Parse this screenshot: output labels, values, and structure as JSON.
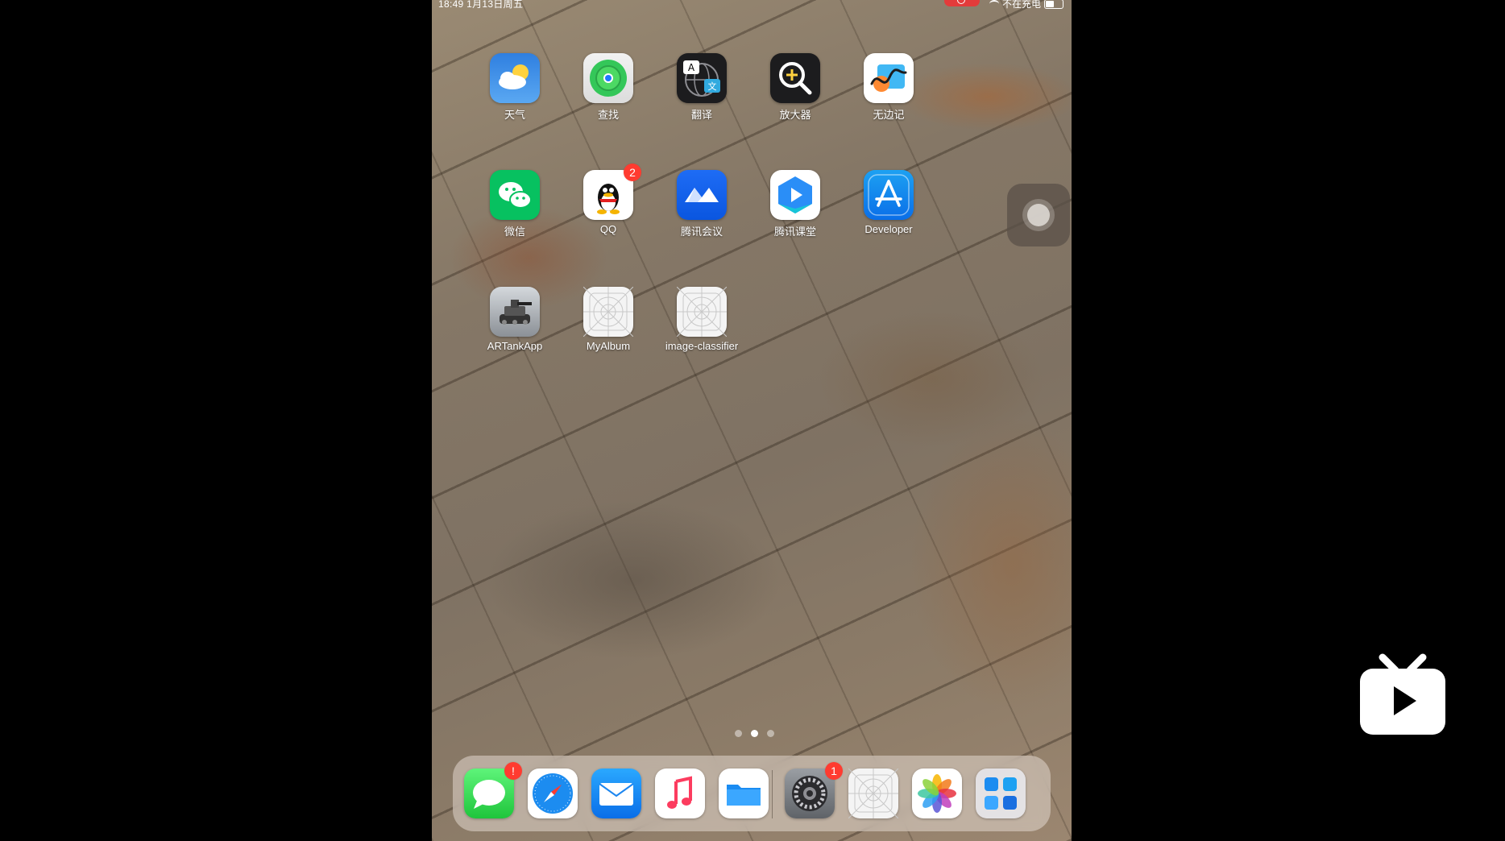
{
  "status_bar": {
    "time": "18:49  1月13日周五",
    "charging": "不在充电"
  },
  "apps": [
    {
      "name": "weather",
      "label": "天气",
      "icon": "weather-icon"
    },
    {
      "name": "find-my",
      "label": "查找",
      "icon": "find-my-icon"
    },
    {
      "name": "translate",
      "label": "翻译",
      "icon": "translate-icon"
    },
    {
      "name": "magnifier",
      "label": "放大器",
      "icon": "magnifier-icon"
    },
    {
      "name": "freeform",
      "label": "无边记",
      "icon": "freeform-icon"
    },
    {
      "name": "wechat",
      "label": "微信",
      "icon": "wechat-icon"
    },
    {
      "name": "qq",
      "label": "QQ",
      "icon": "qq-icon",
      "badge": "2"
    },
    {
      "name": "tencent-meeting",
      "label": "腾讯会议",
      "icon": "tencent-meeting-icon"
    },
    {
      "name": "tencent-classroom",
      "label": "腾讯课堂",
      "icon": "tencent-classroom-icon"
    },
    {
      "name": "developer",
      "label": "Developer",
      "icon": "developer-icon"
    },
    {
      "name": "artankapp",
      "label": "ARTankApp",
      "icon": "tank-icon"
    },
    {
      "name": "myalbum",
      "label": "MyAlbum",
      "icon": "placeholder-app-icon"
    },
    {
      "name": "image-classifier",
      "label": "image-classifier",
      "icon": "placeholder-app-icon"
    }
  ],
  "page_indicator": {
    "pages": 3,
    "current": 2
  },
  "dock": [
    {
      "name": "messages",
      "icon": "messages-icon",
      "badge": "!"
    },
    {
      "name": "safari",
      "icon": "safari-icon"
    },
    {
      "name": "mail",
      "icon": "mail-icon"
    },
    {
      "name": "music",
      "icon": "music-icon"
    },
    {
      "name": "files",
      "icon": "files-icon"
    },
    {
      "name": "settings",
      "icon": "settings-icon",
      "badge": "1"
    },
    {
      "name": "placeholder-app",
      "icon": "placeholder-app-icon"
    },
    {
      "name": "photos",
      "icon": "photos-icon"
    },
    {
      "name": "app-library",
      "icon": "app-library-icon"
    }
  ],
  "colors": {
    "badge": "#ff3b30",
    "recording": "#e33b3b"
  }
}
